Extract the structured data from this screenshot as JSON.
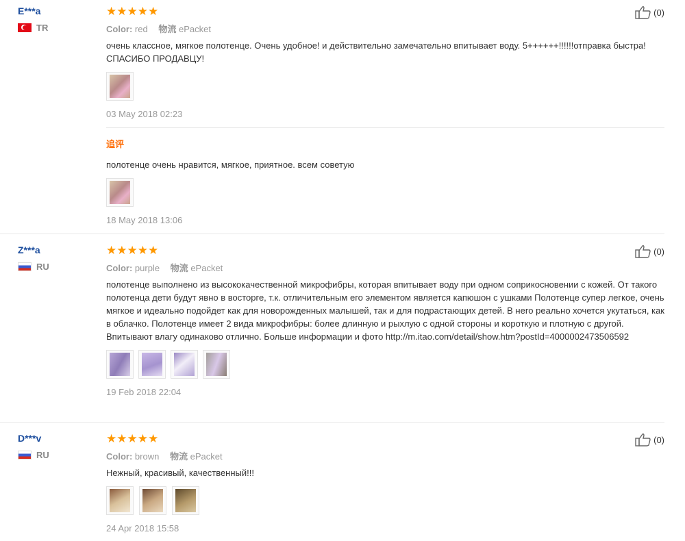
{
  "reviews": [
    {
      "user": "E***a",
      "country": "TR",
      "rating": "★★★★★",
      "color_label": "Color:",
      "color_value": "red",
      "shipping_label": "物流",
      "shipping_value": "ePacket",
      "text": "очень классное, мягкое полотенце. Очень удобное! и действительно замечательно впитывает воду. 5++++++!!!!!!отправка быстра! СПАСИБО ПРОДАВЦУ!",
      "date": "03 May 2018 02:23",
      "helpful": "(0)",
      "followup": {
        "label": "追评",
        "text": "полотенце очень нравится, мягкое, приятное. всем советую",
        "date": "18 May 2018 13:06"
      }
    },
    {
      "user": "Z***a",
      "country": "RU",
      "rating": "★★★★★",
      "color_label": "Color:",
      "color_value": "purple",
      "shipping_label": "物流",
      "shipping_value": "ePacket",
      "text": "полотенце выполнено из высококачественной микрофибры, которая впитывает воду при одном соприкосновении с кожей. От такого полотенца дети будут явно в восторге, т.к. отличительным его элементом является капюшон с ушками Полотенце супер легкое, очень мягкое и идеально подойдет как для новорожденных малышей, так и для подрастающих детей. В него реально хочется укутаться, как в облачко. Полотенце имеет 2 вида микрофибры: более длинную и рыхлую с одной стороны и короткую и плотную с другой. Впитывают влагу одинаково отлично. Больше информации и фото http://m.itao.com/detail/show.htm?postId=4000002473506592",
      "date": "19 Feb 2018 22:04",
      "helpful": "(0)"
    },
    {
      "user": "D***v",
      "country": "RU",
      "rating": "★★★★★",
      "color_label": "Color:",
      "color_value": "brown",
      "shipping_label": "物流",
      "shipping_value": "ePacket",
      "text": "Нежный, красивый, качественный!!!",
      "date": "24 Apr 2018 15:58",
      "helpful": "(0)"
    }
  ],
  "icons": {
    "helpful": "thumbs-up-icon",
    "flag_tr": "turkey-flag-icon",
    "flag_ru": "russia-flag-icon"
  },
  "colors": {
    "user_link": "#1d4e9e",
    "stars": "#ff9800",
    "followup": "#ff6a00",
    "muted": "#999999"
  }
}
